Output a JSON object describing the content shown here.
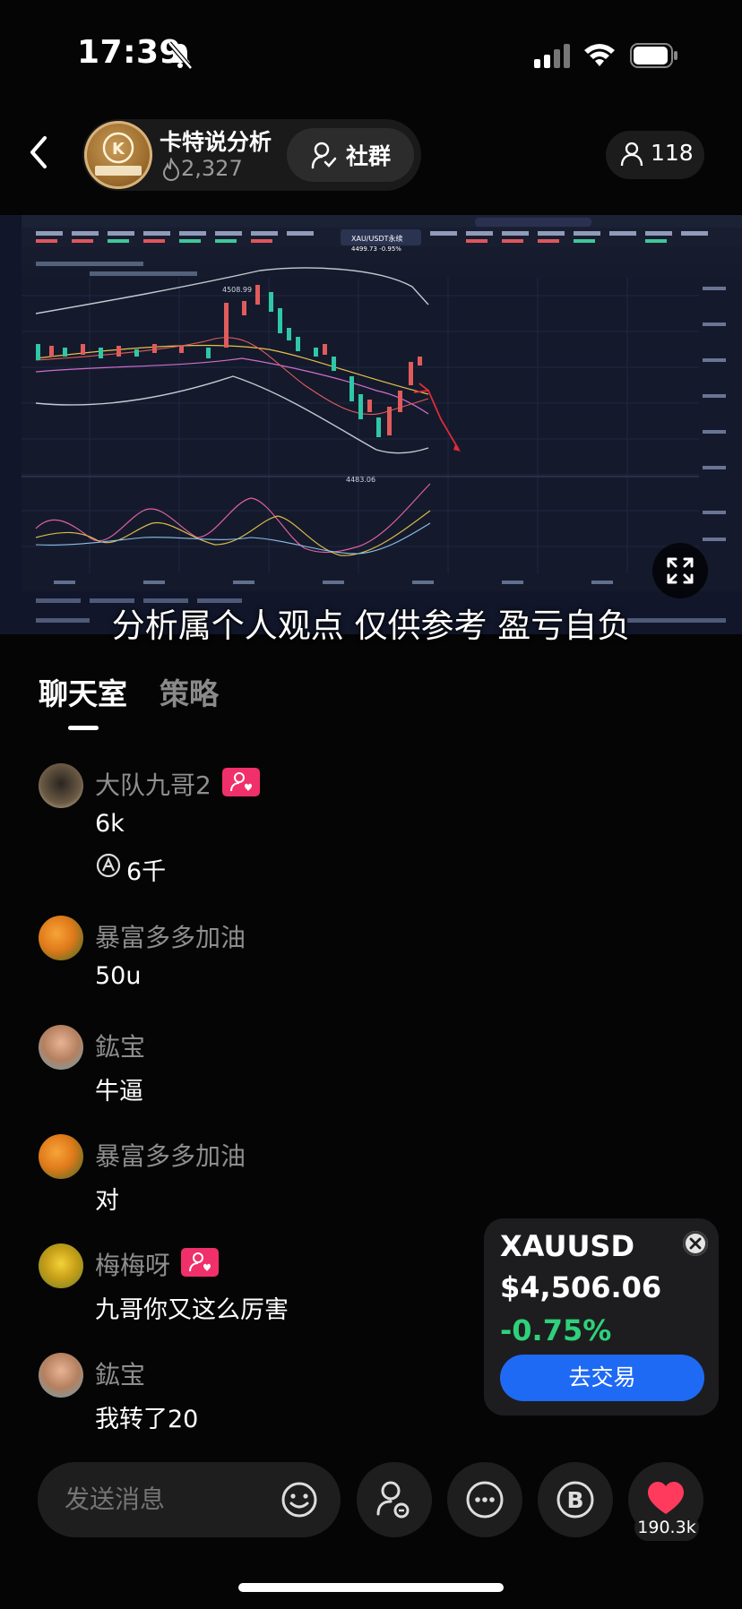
{
  "status_bar": {
    "time": "17:39"
  },
  "header": {
    "host_name": "卡特说分析",
    "heat": "2,327",
    "community_label": "社群",
    "viewer_count": "118"
  },
  "video": {
    "disclaimer": "分析属个人观点 仅供参考 盈亏自负",
    "chart_labels": {
      "high": "4508.99",
      "low": "4483.06",
      "pair": "XAU/USDT永续",
      "pair_price": "4499.73 -0.95%"
    }
  },
  "tabs": [
    {
      "label": "聊天室",
      "active": true
    },
    {
      "label": "策略",
      "active": false
    }
  ],
  "messages": [
    {
      "user": "大队九哥2",
      "badge": true,
      "text": "6k",
      "ticker_text": "6千"
    },
    {
      "user": "暴富多多加油",
      "badge": false,
      "text": "50u"
    },
    {
      "user": "鈜宝",
      "badge": false,
      "text": "牛逼"
    },
    {
      "user": "暴富多多加油",
      "badge": false,
      "text": "对"
    },
    {
      "user": "梅梅呀",
      "badge": true,
      "text": "九哥你又这么厉害"
    },
    {
      "user": "鈜宝",
      "badge": false,
      "text": "我转了20"
    }
  ],
  "ticker_card": {
    "symbol": "XAUUSD",
    "price": "$4,506.06",
    "change": "-0.75%",
    "trade_label": "去交易"
  },
  "bottom_bar": {
    "input_placeholder": "发送消息",
    "like_count": "190.3k"
  },
  "colors": {
    "accent": "#1f6af5",
    "positive": "#2ed17a",
    "badge": "#f0306a",
    "like": "#ff3a5c"
  }
}
